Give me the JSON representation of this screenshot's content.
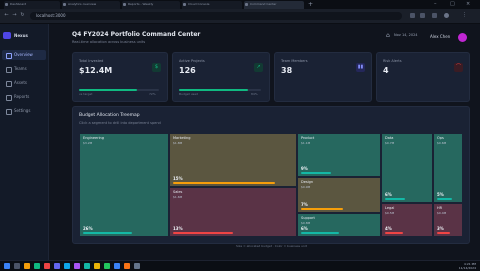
{
  "browser": {
    "tabs": [
      {
        "title": "Dashboard",
        "active": false
      },
      {
        "title": "Analytics overview",
        "active": false
      },
      {
        "title": "Reports - Weekly",
        "active": false
      },
      {
        "title": "Cloud Console",
        "active": false
      },
      {
        "title": "Command Center",
        "active": true
      }
    ],
    "address": "localhost:3000"
  },
  "sidebar": {
    "brand": "Nexus",
    "items": [
      {
        "label": "Overview",
        "active": true
      },
      {
        "label": "Teams",
        "active": false
      },
      {
        "label": "Assets",
        "active": false
      },
      {
        "label": "Reports",
        "active": false
      },
      {
        "label": "Settings",
        "active": false
      }
    ]
  },
  "header": {
    "title": "Q4 FY2024 Portfolio Command Center",
    "subtitle": "Real-time allocation across business units",
    "date": "Nov 14, 2024",
    "user": "Alex Chen"
  },
  "kpis": [
    {
      "label": "Total Invested",
      "value": "$12.4M",
      "icon": "dollar-icon",
      "color": "#10b981",
      "progress": 0.72,
      "foot_left": "vs target",
      "foot_right": "72%"
    },
    {
      "label": "Active Projects",
      "value": "126",
      "icon": "trend-up-icon",
      "color": "#10b981",
      "progress": 0.84,
      "foot_left": "Budget used",
      "foot_right": "84%"
    },
    {
      "label": "Team Members",
      "value": "38",
      "icon": "users-icon",
      "color": "#6366f1",
      "progress": 0,
      "foot_left": "",
      "foot_right": ""
    },
    {
      "label": "Risk Alerts",
      "value": "4",
      "icon": "alert-icon",
      "color": "#ef4444",
      "progress": 0,
      "foot_left": "",
      "foot_right": ""
    }
  ],
  "treemap": {
    "title": "Budget Allocation Treemap",
    "subtitle": "Click a segment to drill into department spend",
    "legend": "Size = allocated budget   ·   Color = business unit",
    "cells": [
      {
        "name": "Engineering",
        "value": "$3.2M",
        "pct": "26%",
        "color": "#26685f",
        "bar": "#14b8a6",
        "fill": 0.6
      },
      {
        "name": "Marketing",
        "value": "$1.8M",
        "pct": "15%",
        "color": "#5b5640",
        "bar": "#f59e0b",
        "fill": 0.85
      },
      {
        "name": "Sales",
        "value": "$1.6M",
        "pct": "13%",
        "color": "#5a3346",
        "bar": "#ef4444",
        "fill": 0.5
      },
      {
        "name": "Product",
        "value": "$1.1M",
        "pct": "9%",
        "color": "#26685f",
        "bar": "#14b8a6",
        "fill": 0.4
      },
      {
        "name": "Design",
        "value": "$0.9M",
        "pct": "7%",
        "color": "#5b5640",
        "bar": "#f59e0b",
        "fill": 0.55
      },
      {
        "name": "Support",
        "value": "$0.8M",
        "pct": "6%",
        "color": "#26685f",
        "bar": "#14b8a6",
        "fill": 0.5
      },
      {
        "name": "Data",
        "value": "$0.7M",
        "pct": "6%",
        "color": "#26685f",
        "bar": "#14b8a6",
        "fill": 0.45
      },
      {
        "name": "Ops",
        "value": "$0.6M",
        "pct": "5%",
        "color": "#26685f",
        "bar": "#14b8a6",
        "fill": 0.7
      },
      {
        "name": "Legal",
        "value": "$0.5M",
        "pct": "4%",
        "color": "#5a3346",
        "bar": "#ef4444",
        "fill": 0.4
      },
      {
        "name": "HR",
        "value": "$0.4M",
        "pct": "3%",
        "color": "#5a3346",
        "bar": "#ef4444",
        "fill": 0.6
      }
    ]
  },
  "taskbar": {
    "time": "4:21 PM",
    "date": "11/14/2024"
  }
}
